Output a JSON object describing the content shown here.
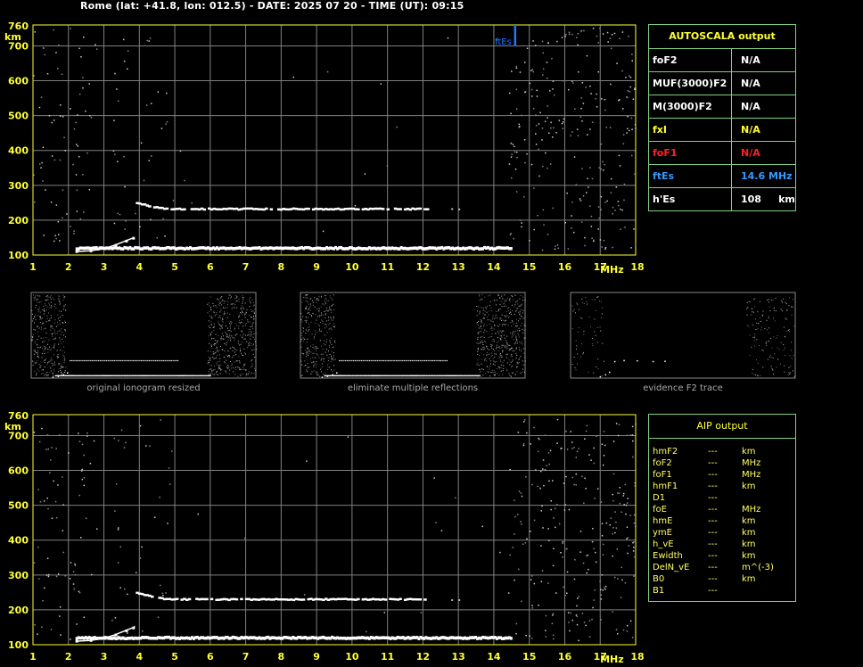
{
  "header": {
    "title": "Rome (lat: +41.8, lon: 012.5) - DATE: 2025 07 20 - TIME (UT): 09:15"
  },
  "colors": {
    "axis_text": "#ffff33",
    "grid": "#808080",
    "frame": "#7fd07f",
    "trace": "#ffffff",
    "fbEs_marker": "#1e78ff",
    "foF1_color": "#ff2020",
    "ftEs_color": "#3399ff"
  },
  "autoscala": {
    "title": "AUTOSCALA output",
    "rows": [
      {
        "label": "foF2",
        "value": "N/A",
        "color": "#ffffff"
      },
      {
        "label": "MUF(3000)F2",
        "value": "N/A",
        "color": "#ffffff"
      },
      {
        "label": "M(3000)F2",
        "value": "N/A",
        "color": "#ffffff"
      },
      {
        "label": "fxI",
        "value": "N/A",
        "color": "#ffff33"
      },
      {
        "label": "foF1",
        "value": "N/A",
        "color": "#ff2020"
      },
      {
        "label": "ftEs",
        "value": "14.6 MHz",
        "color": "#3399ff"
      },
      {
        "label": "h'Es",
        "value": "108     km",
        "color": "#ffffff"
      }
    ]
  },
  "aip": {
    "title": "AIP output",
    "rows": [
      {
        "name": "hmF2",
        "value": "---",
        "unit": "km"
      },
      {
        "name": "foF2",
        "value": "---",
        "unit": "MHz"
      },
      {
        "name": "foF1",
        "value": "---",
        "unit": "MHz"
      },
      {
        "name": "hmF1",
        "value": "---",
        "unit": "km"
      },
      {
        "name": "D1",
        "value": "---",
        "unit": ""
      },
      {
        "name": "foE",
        "value": "---",
        "unit": "MHz"
      },
      {
        "name": "hmE",
        "value": "---",
        "unit": "km"
      },
      {
        "name": "ymE",
        "value": "---",
        "unit": "km"
      },
      {
        "name": "h_vE",
        "value": "---",
        "unit": "km"
      },
      {
        "name": "Ewidth",
        "value": "---",
        "unit": "km"
      },
      {
        "name": "DelN_vE",
        "value": "---",
        "unit": "m^(-3)"
      },
      {
        "name": "B0",
        "value": "---",
        "unit": "km"
      },
      {
        "name": "B1",
        "value": "---",
        "unit": ""
      }
    ]
  },
  "thumbnails": [
    {
      "caption": "original ionogram resized"
    },
    {
      "caption": "eliminate multiple reflections"
    },
    {
      "caption": "evidence F2 trace"
    }
  ],
  "chart_data": [
    {
      "type": "scatter",
      "name": "top-ionogram",
      "xlabel": "MHz",
      "ylabel": "km",
      "xlim": [
        1,
        18
      ],
      "ylim": [
        100,
        760
      ],
      "x_ticks": [
        "1",
        "2",
        "3",
        "4",
        "5",
        "6",
        "7",
        "8",
        "9",
        "10",
        "11",
        "12",
        "13",
        "14",
        "15",
        "16",
        "17",
        "18"
      ],
      "y_ticks": [
        "100",
        "200",
        "300",
        "400",
        "500",
        "600",
        "700",
        "760"
      ],
      "grid": true,
      "es_marker": {
        "label": "ftEs",
        "x": 14.6
      },
      "traces": {
        "E_layer": {
          "x_start": 2.2,
          "x_end": 14.5,
          "height": 120
        },
        "Es_rise": [
          [
            2.2,
            110
          ],
          [
            2.6,
            112
          ],
          [
            3.0,
            118
          ],
          [
            3.3,
            128
          ],
          [
            3.6,
            140
          ],
          [
            3.8,
            148
          ]
        ],
        "F_layer": {
          "x_start": 3.9,
          "x_end": 12.1,
          "height_start": 248,
          "height": 232
        },
        "F_extra_points": [
          [
            12.8,
            232
          ],
          [
            13.0,
            231
          ]
        ]
      }
    },
    {
      "type": "scatter",
      "name": "bottom-ionogram",
      "xlabel": "MHz",
      "ylabel": "km",
      "xlim": [
        1,
        18
      ],
      "ylim": [
        100,
        760
      ],
      "x_ticks": [
        "1",
        "2",
        "3",
        "4",
        "5",
        "6",
        "7",
        "8",
        "9",
        "10",
        "11",
        "12",
        "13",
        "14",
        "15",
        "16",
        "17",
        "18"
      ],
      "y_ticks": [
        "100",
        "200",
        "300",
        "400",
        "500",
        "600",
        "700",
        "760"
      ],
      "grid": true,
      "traces": {
        "E_layer": {
          "x_start": 2.2,
          "x_end": 14.5,
          "height": 120
        },
        "Es_rise": [
          [
            2.2,
            110
          ],
          [
            2.6,
            112
          ],
          [
            3.0,
            118
          ],
          [
            3.3,
            128
          ],
          [
            3.6,
            140
          ],
          [
            3.8,
            148
          ]
        ],
        "F_layer": {
          "x_start": 3.9,
          "x_end": 12.1,
          "height_start": 248,
          "height": 230
        },
        "F_extra_points": [
          [
            12.8,
            228
          ],
          [
            13.0,
            228
          ]
        ]
      }
    }
  ]
}
